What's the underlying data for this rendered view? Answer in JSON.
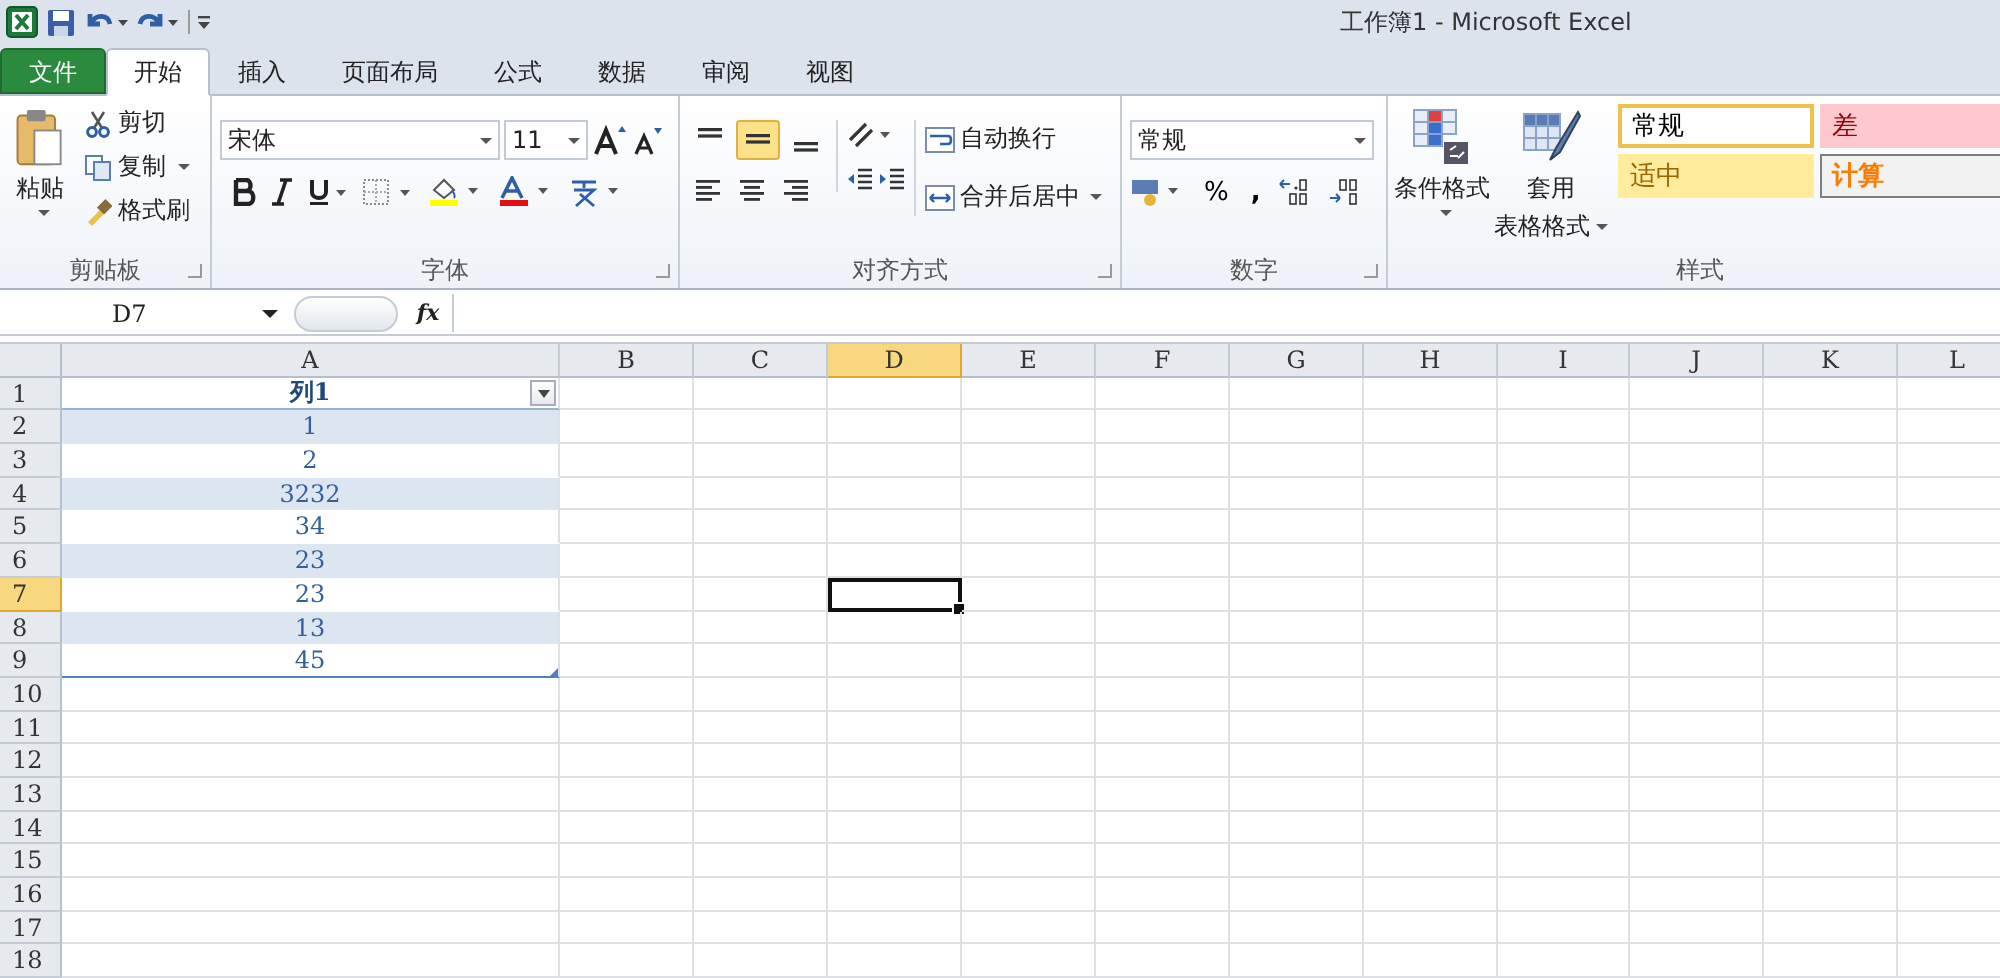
{
  "window": {
    "title": "工作簿1  -  Microsoft Excel"
  },
  "tabs": [
    {
      "label": "文件",
      "kind": "file",
      "selected": false
    },
    {
      "label": "开始",
      "kind": "tab",
      "selected": true
    },
    {
      "label": "插入",
      "kind": "tab",
      "selected": false
    },
    {
      "label": "页面布局",
      "kind": "tab",
      "selected": false
    },
    {
      "label": "公式",
      "kind": "tab",
      "selected": false
    },
    {
      "label": "数据",
      "kind": "tab",
      "selected": false
    },
    {
      "label": "审阅",
      "kind": "tab",
      "selected": false
    },
    {
      "label": "视图",
      "kind": "tab",
      "selected": false
    }
  ],
  "clipboard": {
    "paste": "粘贴",
    "cut": "剪切",
    "copy": "复制",
    "format_painter": "格式刷",
    "group_label": "剪贴板"
  },
  "font": {
    "name": "宋体",
    "size": "11",
    "group_label": "字体"
  },
  "alignment": {
    "buttons": [
      {
        "kind": "top",
        "selected": false
      },
      {
        "kind": "middle",
        "selected": true
      },
      {
        "kind": "bottom",
        "selected": false
      }
    ],
    "wrap_text": "自动换行",
    "merge_center": "合并后居中",
    "group_label": "对齐方式"
  },
  "number": {
    "format": "常规",
    "percent": "%",
    "comma": ",",
    "group_label": "数字"
  },
  "styles": {
    "conditional_format": "条件格式",
    "format_as_table": [
      "套用",
      "表格格式"
    ],
    "cell_styles": [
      {
        "label": "常规",
        "color": "#ffffff"
      },
      {
        "label": "差",
        "color": "#ffc7ce"
      },
      {
        "label": "适中",
        "color": "#ffeb9c"
      },
      {
        "label": "计算",
        "color": "#f2f2f2"
      }
    ],
    "group_label": "样式"
  },
  "formula_bar": {
    "name_box": "D7",
    "function_symbol": "fx"
  },
  "columns": [
    {
      "label": "A",
      "selected": false
    },
    {
      "label": "B",
      "selected": false
    },
    {
      "label": "C",
      "selected": false
    },
    {
      "label": "D",
      "selected": true
    },
    {
      "label": "E",
      "selected": false
    },
    {
      "label": "F",
      "selected": false
    },
    {
      "label": "G",
      "selected": false
    },
    {
      "label": "H",
      "selected": false
    },
    {
      "label": "I",
      "selected": false
    },
    {
      "label": "J",
      "selected": false
    },
    {
      "label": "K",
      "selected": false
    },
    {
      "label": "L",
      "selected": false
    }
  ],
  "rows": [
    {
      "label": "1",
      "selected": false
    },
    {
      "label": "2",
      "selected": false
    },
    {
      "label": "3",
      "selected": false
    },
    {
      "label": "4",
      "selected": false
    },
    {
      "label": "5",
      "selected": false
    },
    {
      "label": "6",
      "selected": false
    },
    {
      "label": "7",
      "selected": true
    },
    {
      "label": "8",
      "selected": false
    },
    {
      "label": "9",
      "selected": false
    },
    {
      "label": "10",
      "selected": false
    },
    {
      "label": "11",
      "selected": false
    },
    {
      "label": "12",
      "selected": false
    },
    {
      "label": "13",
      "selected": false
    },
    {
      "label": "14",
      "selected": false
    },
    {
      "label": "15",
      "selected": false
    },
    {
      "label": "16",
      "selected": false
    },
    {
      "label": "17",
      "selected": false
    },
    {
      "label": "18",
      "selected": false
    }
  ],
  "table": {
    "header": "列1",
    "values": [
      "1",
      "2",
      "3232",
      "34",
      "23",
      "23",
      "13",
      "45"
    ]
  }
}
